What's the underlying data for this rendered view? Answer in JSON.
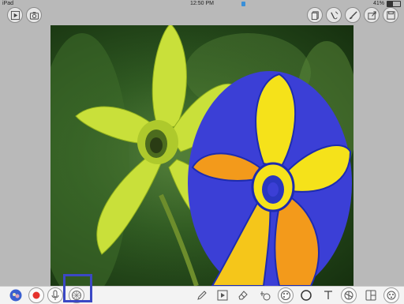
{
  "status_bar": {
    "device": "iPad",
    "time": "12:50 PM",
    "battery": "41%",
    "battery_level": 0.41
  },
  "top_left_buttons": [
    {
      "name": "play-button",
      "icon": "play-icon"
    },
    {
      "name": "camera-button",
      "icon": "camera-icon"
    }
  ],
  "top_right_buttons": [
    {
      "name": "layers-button",
      "icon": "layers-icon"
    },
    {
      "name": "edit-paint-button",
      "icon": "brush-edit-icon"
    },
    {
      "name": "brush-button",
      "icon": "brush-icon"
    },
    {
      "name": "share-button",
      "icon": "share-icon"
    },
    {
      "name": "save-button",
      "icon": "save-icon"
    }
  ],
  "bottom_toolbar": [
    {
      "name": "avatar-button",
      "icon": "avatar-icon"
    },
    {
      "name": "record-button",
      "icon": "record-icon"
    },
    {
      "name": "microphone-button",
      "icon": "microphone-icon"
    },
    {
      "name": "stamp-tool-button",
      "icon": "stamp-icon",
      "selected": true
    },
    {
      "name": "pencil-tool-button",
      "icon": "pencil-icon"
    },
    {
      "name": "play-frame-button",
      "icon": "play-frame-icon"
    },
    {
      "name": "eraser-tool-button",
      "icon": "eraser-icon"
    },
    {
      "name": "effect-tool-button",
      "icon": "effect-icon"
    },
    {
      "name": "palette-tool-button",
      "icon": "palette-icon"
    },
    {
      "name": "shape-tool-button",
      "icon": "circle-shape-icon"
    },
    {
      "name": "text-tool-button",
      "icon": "text-icon"
    },
    {
      "name": "filter-tool-button",
      "icon": "filter-icon"
    },
    {
      "name": "layout-tool-button",
      "icon": "layout-icon"
    },
    {
      "name": "settings-tool-button",
      "icon": "settings-icon"
    }
  ],
  "colors": {
    "accent_selection": "#3b48c4",
    "flower_yellow_green": "#c9e03a",
    "filter_blue": "#3b3fd6",
    "filter_yellow": "#f5e21a",
    "filter_orange": "#f39a1b",
    "record_red": "#e5312c"
  }
}
